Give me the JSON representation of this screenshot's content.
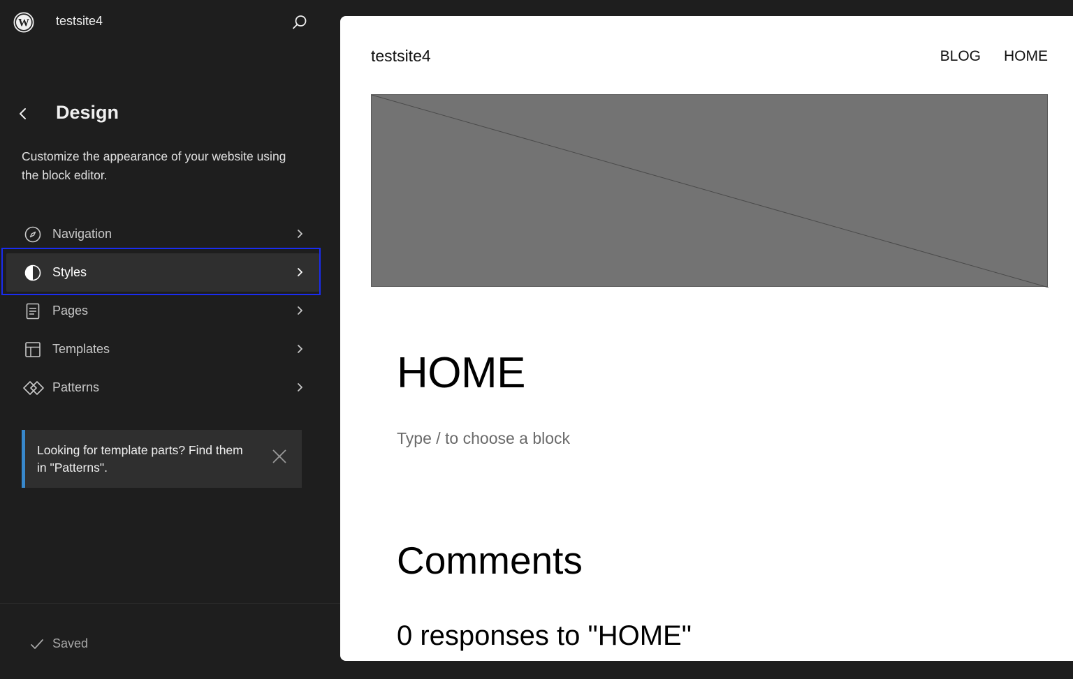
{
  "sidebar": {
    "site_name": "testsite4",
    "title": "Design",
    "description": "Customize the appearance of your website using the block editor.",
    "items": [
      {
        "label": "Navigation",
        "icon": "compass-icon"
      },
      {
        "label": "Styles",
        "icon": "half-circle-icon",
        "active": true
      },
      {
        "label": "Pages",
        "icon": "page-icon"
      },
      {
        "label": "Templates",
        "icon": "layout-icon"
      },
      {
        "label": "Patterns",
        "icon": "diamond-icon"
      }
    ],
    "notice": {
      "text": "Looking for template parts? Find them in \"Patterns\"."
    },
    "status": "Saved"
  },
  "preview": {
    "site_title": "testsite4",
    "nav": [
      "BLOG",
      "HOME"
    ],
    "page_heading": "HOME",
    "block_placeholder": "Type / to choose a block",
    "comments_heading": "Comments",
    "responses_text": "0 responses to \"HOME\""
  },
  "colors": {
    "sidebar_bg": "#1e1e1e",
    "active_item_bg": "#2f2f2f",
    "focus_ring": "#1a2cf0",
    "notice_accent": "#3888cc",
    "image_placeholder": "#737373"
  }
}
